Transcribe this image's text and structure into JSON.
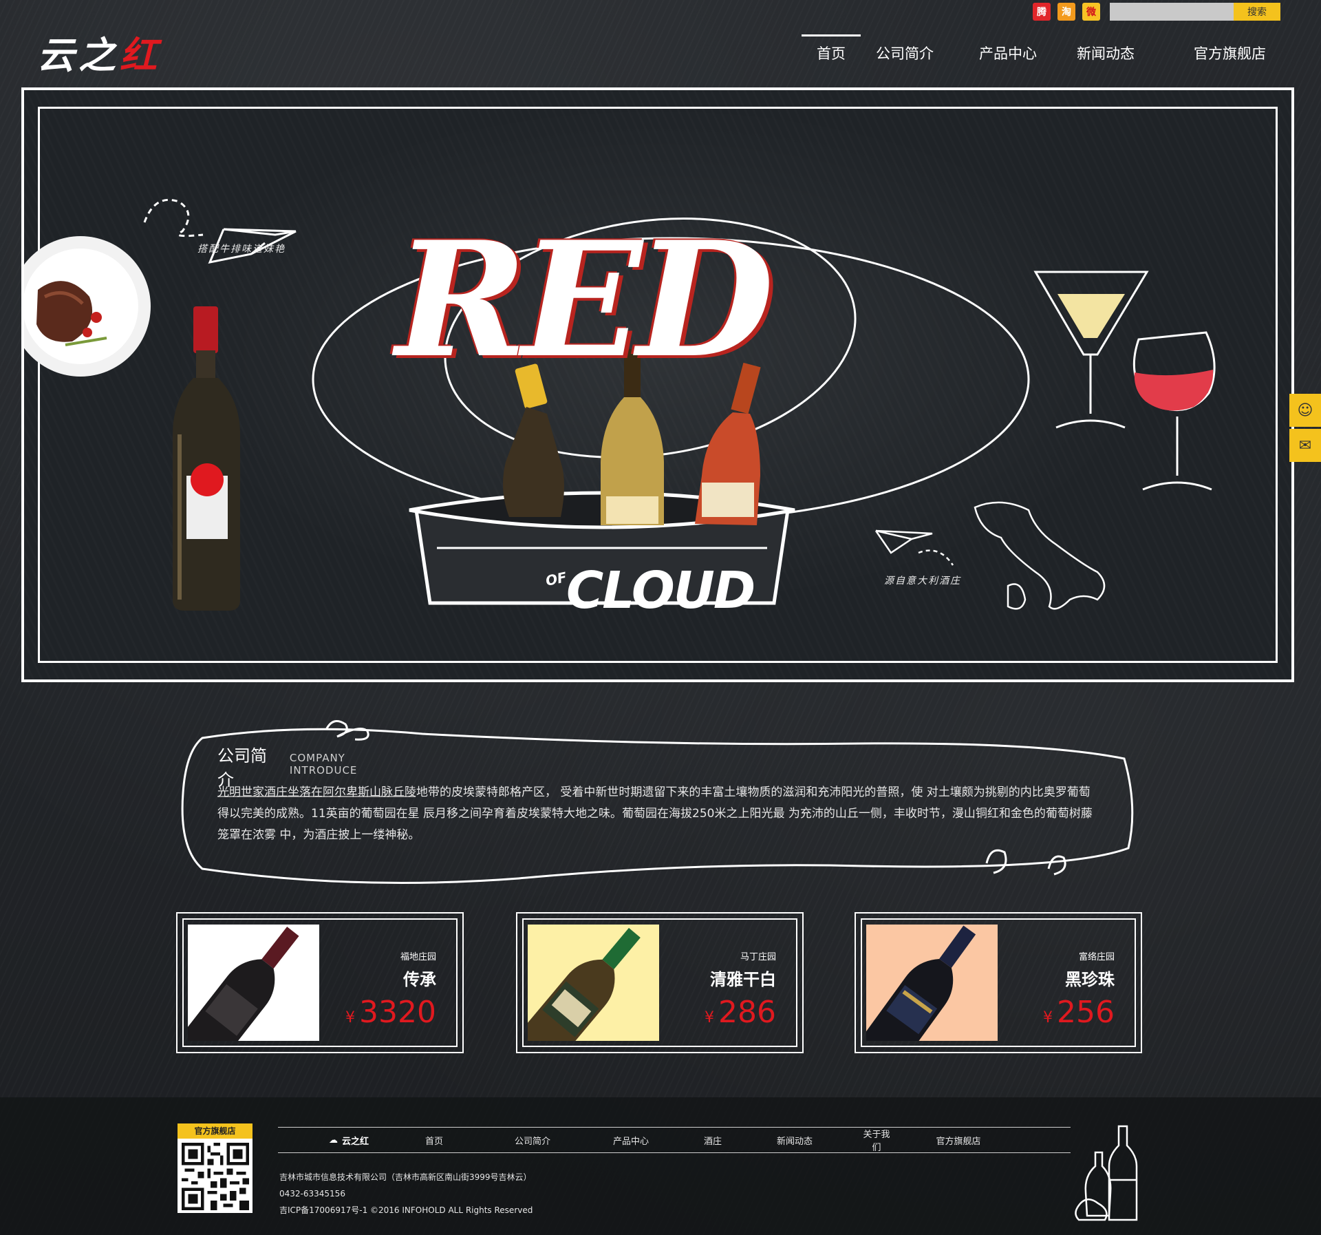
{
  "header": {
    "logo_main": "云之",
    "logo_red": "红",
    "social": {
      "tencent": "腾",
      "taobao": "淘",
      "weibo": "微"
    },
    "search": {
      "placeholder": "",
      "button_label": "搜索"
    },
    "nav": [
      {
        "label": "首页",
        "active": true
      },
      {
        "label": "公司简介",
        "active": false
      },
      {
        "label": "产品中心",
        "active": false
      },
      {
        "label": "新闻动态",
        "active": false
      },
      {
        "label": "官方旗舰店",
        "active": false
      }
    ]
  },
  "hero": {
    "title": "RED",
    "of": "OF",
    "subtitle": "CLOUD",
    "caption_left": "搭配牛排味道妹艳",
    "caption_right": "源自意大利酒庄"
  },
  "intro": {
    "title_cn": "公司简介",
    "title_en": "COMPANY INTRODUCE",
    "text": "光明世家酒庄坐落在阿尔卑斯山脉丘陵地带的皮埃蒙特郎格产区， 受着中新世时期遗留下来的丰富土壤物质的滋润和充沛阳光的普照，使 对土壤颇为挑剔的内比奥罗葡萄得以完美的成熟。11英亩的葡萄园在星 辰月移之间孕育着皮埃蒙特大地之味。葡萄园在海拔250米之上阳光最 为充沛的山丘一侧，丰收时节，漫山铜红和金色的葡萄树藤笼罩在浓雾 中，为酒庄披上一缕神秘。"
  },
  "products": [
    {
      "estate": "福地庄园",
      "name": "传承",
      "currency": "¥",
      "price": "3320",
      "thumb_bg": "#ffffff"
    },
    {
      "estate": "马丁庄园",
      "name": "清雅干白",
      "currency": "¥",
      "price": "286",
      "thumb_bg": "#fdf0a6"
    },
    {
      "estate": "富络庄园",
      "name": "黑珍珠",
      "currency": "¥",
      "price": "256",
      "thumb_bg": "#fbc7a3"
    }
  ],
  "footer": {
    "qr_label": "官方旗舰店",
    "brand": "云之红",
    "nav": [
      "首页",
      "公司简介",
      "产品中心",
      "酒庄",
      "新闻动态",
      "关于我们",
      "官方旗舰店"
    ],
    "company": "吉林市城市信息技术有限公司（吉林市高新区南山街3999号吉林云）",
    "phone": "0432-63345156",
    "copyright": "吉ICP备17006917号-1 ©2016 INFOHOLD ALL Rights Reserved"
  },
  "colors": {
    "accent_yellow": "#f4c21d",
    "price_red": "#e0191f",
    "background": "#222529"
  }
}
